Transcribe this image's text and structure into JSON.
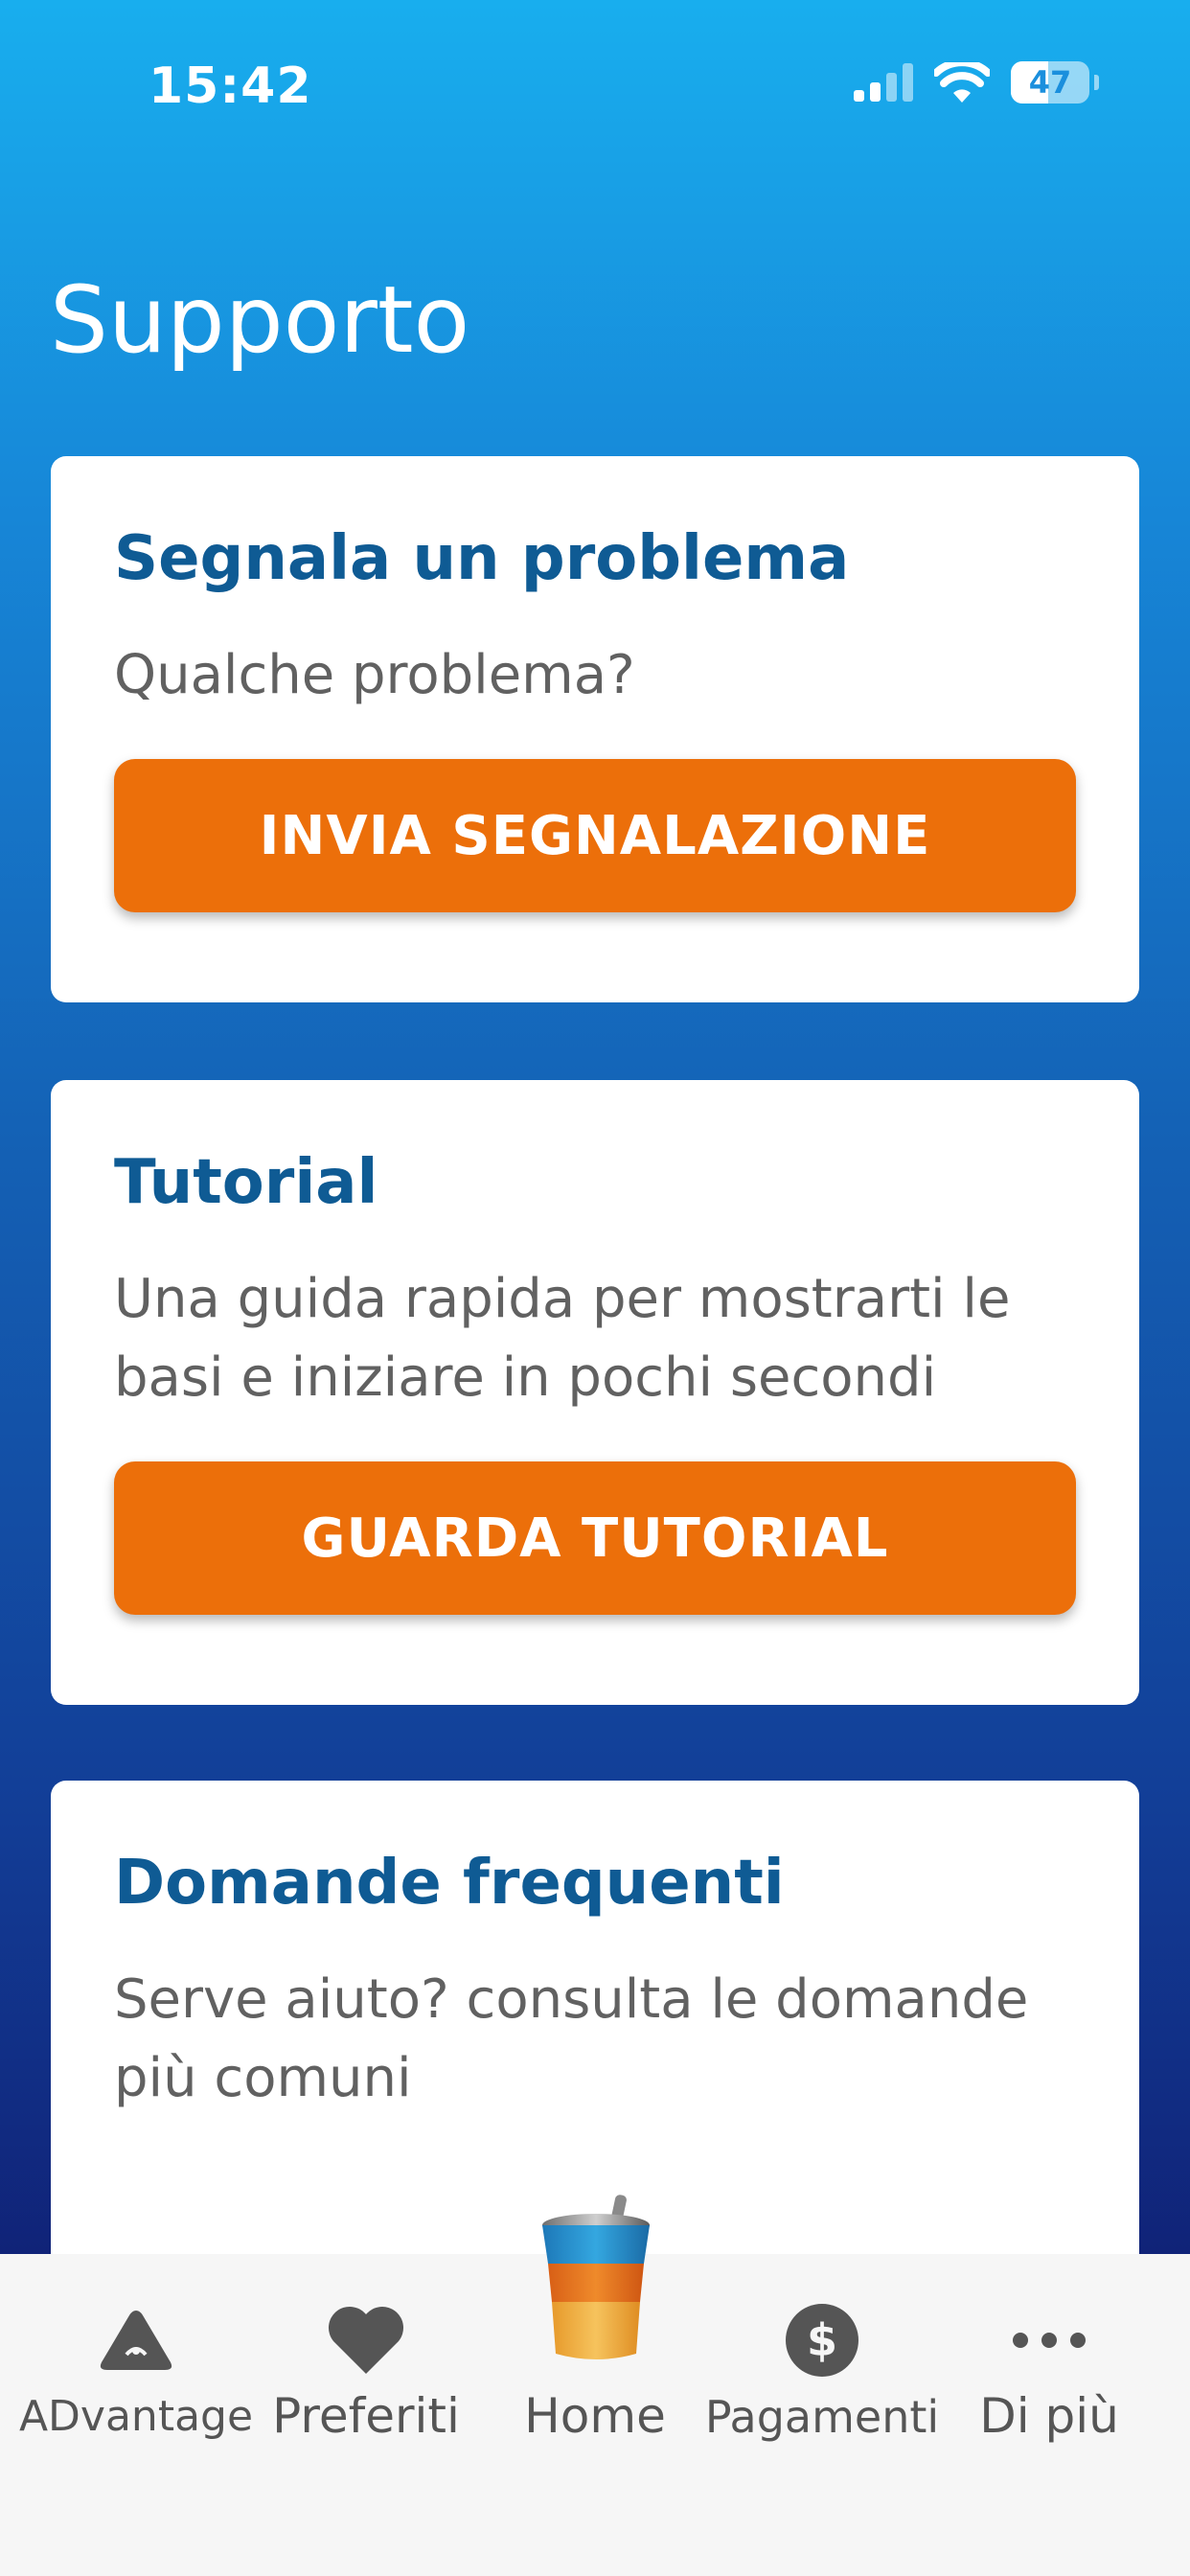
{
  "status_bar": {
    "time": "15:42",
    "battery": "47",
    "icons": [
      "signal-icon",
      "wifi-icon",
      "battery-icon"
    ]
  },
  "page": {
    "title": "Supporto"
  },
  "cards": [
    {
      "title": "Segnala un problema",
      "description": "Qualche problema?",
      "button_label": "INVIA SEGNALAZIONE"
    },
    {
      "title": "Tutorial",
      "description": "Una guida rapida per mostrarti le basi e iniziare in pochi secondi",
      "button_label": "GUARDA TUTORIAL"
    },
    {
      "title": "Domande frequenti",
      "description": "Serve aiuto? consulta le domande più comuni"
    }
  ],
  "bottom_nav": {
    "items": [
      {
        "label": "ADvantage",
        "icon": "advantage-logo-icon"
      },
      {
        "label": "Preferiti",
        "icon": "heart-icon"
      },
      {
        "label": "Home",
        "icon": "cup-icon"
      },
      {
        "label": "Pagamenti",
        "icon": "dollar-icon"
      },
      {
        "label": "Di più",
        "icon": "more-dots-icon"
      }
    ]
  },
  "colors": {
    "accent_orange": "#ec6f0a",
    "title_blue": "#0f5b94",
    "gradient_top": "#18aeee",
    "gradient_bottom": "#0f166a"
  }
}
